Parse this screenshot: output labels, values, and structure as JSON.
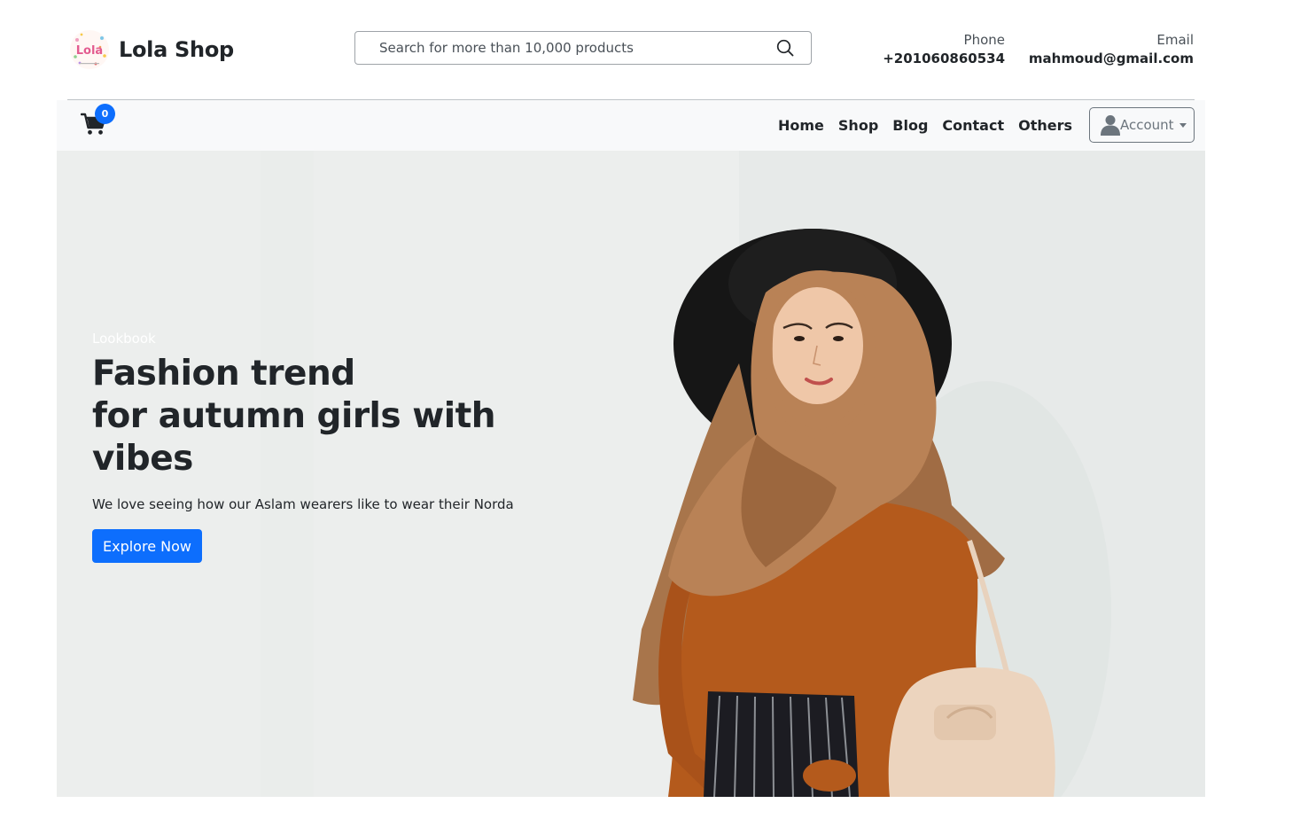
{
  "header": {
    "brand_name": "Lola Shop",
    "logo_text": "Lola",
    "search_placeholder": "Search for more than 10,000 products",
    "phone_label": "Phone",
    "phone_value": "+201060860534",
    "email_label": "Email",
    "email_value": "mahmoud@gmail.com"
  },
  "navbar": {
    "cart_count": "0",
    "links": [
      "Home",
      "Shop",
      "Blog",
      "Contact",
      "Others"
    ],
    "account_label": "Account"
  },
  "hero": {
    "kicker": "Lookbook",
    "title_line1": "Fashion trend",
    "title_line2": "for autumn girls with vibes",
    "description": "We love seeing how our Aslam wearers like to wear their Norda",
    "cta_label": "Explore Now"
  },
  "colors": {
    "primary": "#0d6efd",
    "navbar_bg": "#f8f9fa",
    "text_dark": "#212529",
    "muted": "#6c757d"
  },
  "icons": {
    "search": "search-icon",
    "cart": "cart-icon",
    "account": "user-icon",
    "caret": "caret-down-icon"
  }
}
